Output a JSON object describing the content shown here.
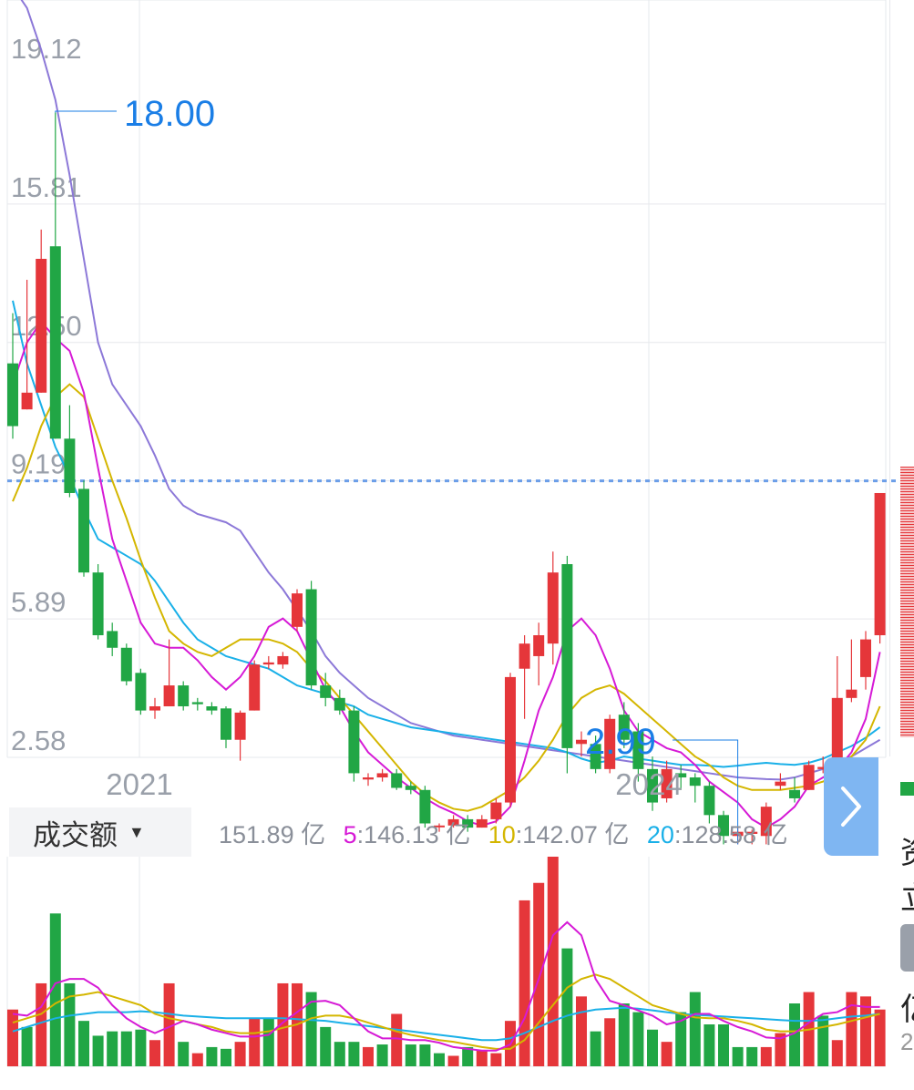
{
  "colors": {
    "up": "#e5363a",
    "down": "#21a645",
    "ma5": "#d61ad6",
    "ma10": "#d4b600",
    "ma20": "#1ab0e8",
    "ma60": "#8c78d8",
    "axis_text": "#9aa0aa",
    "annotation": "#1a7ee6",
    "grid": "#e6e8ec",
    "dashed_line": "#6b9ee8"
  },
  "chart_data": [
    {
      "type": "candlestick",
      "y_ticks": [
        "19.12",
        "15.81",
        "12.50",
        "9.19",
        "5.89",
        "2.58"
      ],
      "x_ticks": [
        "2021",
        "2024"
      ],
      "ylim": [
        2.58,
        19.12
      ],
      "current_price_line": 9.19,
      "annotations": {
        "high_label": "18.00",
        "low_label": "2.99"
      },
      "candles": [
        [
          12.0,
          10.5,
          13.2,
          10.2
        ],
        [
          10.9,
          11.3,
          14.0,
          10.9
        ],
        [
          11.3,
          14.5,
          15.2,
          11.3
        ],
        [
          14.8,
          10.2,
          18.0,
          10.2
        ],
        [
          10.2,
          8.9,
          11.0,
          8.8
        ],
        [
          9.0,
          7.0,
          9.2,
          6.9
        ],
        [
          7.0,
          5.5,
          7.2,
          5.4
        ],
        [
          5.6,
          5.2,
          5.8,
          5.0
        ],
        [
          5.2,
          4.4,
          5.3,
          4.3
        ],
        [
          4.6,
          3.7,
          4.7,
          3.6
        ],
        [
          3.7,
          3.8,
          4.0,
          3.5
        ],
        [
          3.8,
          4.3,
          5.4,
          3.8
        ],
        [
          4.3,
          3.8,
          4.4,
          3.7
        ],
        [
          3.9,
          3.85,
          4.0,
          3.7
        ],
        [
          3.8,
          3.7,
          3.9,
          3.6
        ],
        [
          3.75,
          3.0,
          3.8,
          2.8
        ],
        [
          3.0,
          3.65,
          3.7,
          2.5
        ],
        [
          3.7,
          4.8,
          4.9,
          3.7
        ],
        [
          4.8,
          4.85,
          5.0,
          4.7
        ],
        [
          4.8,
          5.0,
          5.1,
          4.7
        ],
        [
          5.7,
          6.5,
          6.6,
          5.6
        ],
        [
          6.6,
          4.3,
          6.8,
          4.2
        ],
        [
          4.3,
          4.0,
          4.6,
          3.8
        ],
        [
          4.0,
          3.7,
          4.2,
          3.6
        ],
        [
          3.7,
          2.2,
          3.8,
          2.0
        ],
        [
          2.05,
          2.1,
          2.2,
          1.9
        ],
        [
          2.1,
          2.2,
          2.3,
          2.0
        ],
        [
          2.2,
          1.85,
          2.3,
          1.8
        ],
        [
          1.9,
          1.8,
          2.0,
          1.7
        ],
        [
          1.8,
          1.0,
          1.9,
          0.9
        ],
        [
          0.95,
          0.95,
          1.0,
          0.8
        ],
        [
          0.95,
          1.1,
          1.2,
          0.9
        ],
        [
          1.1,
          0.9,
          1.2,
          0.8
        ],
        [
          0.9,
          1.1,
          1.2,
          0.9
        ],
        [
          1.1,
          1.5,
          1.6,
          1.0
        ],
        [
          1.5,
          4.5,
          4.6,
          1.4
        ],
        [
          4.7,
          5.3,
          5.5,
          3.5
        ],
        [
          5.0,
          5.5,
          5.8,
          4.3
        ],
        [
          5.3,
          7.0,
          7.5,
          4.8
        ],
        [
          7.2,
          2.8,
          7.4,
          2.2
        ],
        [
          2.9,
          3.0,
          3.2,
          2.6
        ],
        [
          2.9,
          2.3,
          3.1,
          2.2
        ],
        [
          2.3,
          3.5,
          3.6,
          2.2
        ],
        [
          3.6,
          3.0,
          3.9,
          2.8
        ],
        [
          3.2,
          2.3,
          3.4,
          2.0
        ],
        [
          2.3,
          1.5,
          2.6,
          1.3
        ],
        [
          1.6,
          2.3,
          2.5,
          1.5
        ],
        [
          2.2,
          2.1,
          2.4,
          1.8
        ],
        [
          2.1,
          1.9,
          2.2,
          1.5
        ],
        [
          1.9,
          1.2,
          2.0,
          1.0
        ],
        [
          1.2,
          0.7,
          1.3,
          0.5
        ],
        [
          0.7,
          0.8,
          0.9,
          0.5
        ],
        [
          0.75,
          0.8,
          0.85,
          0.5
        ],
        [
          0.7,
          1.4,
          1.5,
          0.5
        ],
        [
          1.9,
          2.0,
          2.2,
          1.8
        ],
        [
          1.8,
          1.6,
          2.1,
          1.5
        ],
        [
          1.8,
          2.4,
          2.5,
          1.8
        ],
        [
          2.3,
          2.35,
          2.6,
          2.2
        ],
        [
          2.2,
          4.0,
          5.0,
          2.0
        ],
        [
          4.0,
          4.2,
          5.4,
          3.9
        ],
        [
          4.5,
          5.4,
          5.6,
          4.2
        ],
        [
          5.5,
          8.9,
          8.9,
          5.3
        ]
      ],
      "ma_lines": {
        "ma5": [
          11.5,
          12.5,
          13.0,
          12.6,
          12.3,
          11.3,
          9.5,
          7.8,
          6.8,
          5.8,
          5.3,
          5.2,
          5.2,
          4.9,
          4.5,
          4.2,
          4.5,
          5.0,
          5.7,
          5.9,
          5.6,
          4.9,
          4.2,
          3.8,
          3.2,
          2.7,
          2.4,
          2.1,
          1.85,
          1.6,
          1.4,
          1.25,
          1.05,
          0.95,
          1.05,
          1.4,
          2.5,
          3.7,
          4.5,
          5.6,
          5.9,
          5.5,
          4.7,
          3.7,
          3.2,
          3.0,
          2.8,
          2.7,
          2.4,
          2.0,
          1.75,
          1.5,
          1.1,
          0.9,
          1.1,
          1.4,
          1.9,
          2.1,
          2.3,
          2.7,
          3.5,
          5.1
        ],
        "ma10": [
          8.7,
          9.5,
          10.5,
          11.2,
          11.5,
          11.2,
          10.2,
          9.2,
          8.3,
          7.3,
          6.4,
          5.6,
          5.3,
          5.1,
          5.0,
          5.2,
          5.4,
          5.4,
          5.4,
          5.3,
          5.1,
          4.7,
          4.4,
          4.0,
          3.6,
          3.2,
          2.8,
          2.4,
          2.0,
          1.7,
          1.5,
          1.35,
          1.3,
          1.4,
          1.6,
          1.8,
          2.1,
          2.5,
          3.0,
          3.6,
          4.0,
          4.2,
          4.3,
          4.1,
          3.8,
          3.5,
          3.2,
          2.9,
          2.6,
          2.4,
          2.1,
          1.9,
          1.8,
          1.8,
          1.8,
          1.85,
          1.9,
          2.0,
          2.2,
          2.6,
          3.0,
          3.8
        ],
        "ma20": [
          13.5,
          12.0,
          11.0,
          10.0,
          9.3,
          8.5,
          7.8,
          7.6,
          7.4,
          7.2,
          6.8,
          6.3,
          5.8,
          5.4,
          5.2,
          5.0,
          4.9,
          4.8,
          4.7,
          4.5,
          4.3,
          4.2,
          4.1,
          3.9,
          3.8,
          3.6,
          3.5,
          3.4,
          3.3,
          3.25,
          3.2,
          3.15,
          3.1,
          3.05,
          3.0,
          2.95,
          2.9,
          2.85,
          2.8,
          2.7,
          2.55,
          2.45,
          2.5,
          2.6,
          2.55,
          2.5,
          2.45,
          2.4,
          2.4,
          2.38,
          2.35,
          2.38,
          2.42,
          2.45,
          2.42,
          2.4,
          2.45,
          2.55,
          2.7,
          2.85,
          3.05,
          3.3
        ],
        "ma60": [
          21.0,
          20.5,
          19.5,
          18.3,
          16.5,
          14.5,
          12.5,
          11.5,
          11.0,
          10.5,
          9.8,
          9.0,
          8.6,
          8.4,
          8.3,
          8.2,
          8.0,
          7.5,
          7.0,
          6.6,
          6.1,
          5.6,
          5.0,
          4.6,
          4.3,
          4.0,
          3.8,
          3.6,
          3.4,
          3.3,
          3.2,
          3.1,
          3.05,
          3.0,
          2.95,
          2.9,
          2.85,
          2.8,
          2.75,
          2.7,
          2.65,
          2.6,
          2.55,
          2.5,
          2.45,
          2.4,
          2.35,
          2.3,
          2.25,
          2.2,
          2.15,
          2.1,
          2.08,
          2.06,
          2.05,
          2.1,
          2.2,
          2.3,
          2.45,
          2.6,
          2.8,
          3.0
        ]
      }
    },
    {
      "type": "bar",
      "title": "成交额",
      "legend": [
        {
          "label": "151.89 亿",
          "key": "",
          "value": ""
        },
        {
          "label": "5",
          "value": ":146.13 亿"
        },
        {
          "label": "10",
          "value": ":142.07 亿"
        },
        {
          "label": "20",
          "value": ":128.58 亿"
        }
      ],
      "values": [
        65,
        45,
        95,
        175,
        95,
        52,
        35,
        40,
        40,
        42,
        30,
        95,
        28,
        15,
        22,
        20,
        28,
        55,
        55,
        95,
        95,
        85,
        45,
        28,
        28,
        22,
        25,
        60,
        25,
        25,
        15,
        12,
        22,
        18,
        15,
        52,
        190,
        210,
        240,
        135,
        80,
        40,
        55,
        72,
        62,
        42,
        28,
        62,
        85,
        48,
        48,
        22,
        22,
        22,
        38,
        72,
        85,
        58,
        30,
        85,
        80,
        65
      ],
      "up": [
        1,
        0,
        1,
        0,
        0,
        0,
        0,
        0,
        0,
        0,
        1,
        1,
        0,
        1,
        0,
        0,
        1,
        1,
        0,
        1,
        1,
        0,
        0,
        0,
        0,
        1,
        0,
        1,
        0,
        0,
        0,
        1,
        0,
        1,
        1,
        1,
        1,
        1,
        1,
        0,
        1,
        0,
        1,
        0,
        0,
        0,
        1,
        0,
        0,
        0,
        0,
        0,
        0,
        1,
        1,
        0,
        1,
        0,
        1,
        1,
        1,
        1
      ],
      "ma_lines": {
        "ma5": [
          60,
          58,
          68,
          95,
          100,
          100,
          90,
          70,
          55,
          45,
          38,
          45,
          52,
          48,
          42,
          38,
          34,
          34,
          36,
          50,
          62,
          74,
          75,
          70,
          55,
          40,
          32,
          32,
          30,
          30,
          27,
          22,
          20,
          18,
          18,
          25,
          55,
          100,
          150,
          165,
          150,
          100,
          75,
          70,
          64,
          58,
          48,
          52,
          60,
          60,
          52,
          45,
          40,
          33,
          32,
          38,
          50,
          60,
          62,
          70,
          68,
          68
        ],
        "ma10": [
          50,
          55,
          60,
          72,
          80,
          82,
          85,
          80,
          75,
          70,
          60,
          55,
          52,
          48,
          45,
          40,
          38,
          38,
          40,
          44,
          48,
          55,
          58,
          58,
          55,
          50,
          45,
          40,
          36,
          33,
          30,
          28,
          25,
          22,
          20,
          20,
          30,
          50,
          70,
          90,
          100,
          105,
          100,
          90,
          80,
          70,
          65,
          60,
          56,
          55,
          55,
          52,
          48,
          42,
          40,
          40,
          42,
          45,
          48,
          52,
          56,
          60
        ],
        "ma20": [
          40,
          45,
          50,
          55,
          58,
          60,
          62,
          62,
          62,
          63,
          62,
          60,
          58,
          57,
          56,
          55,
          55,
          55,
          55,
          55,
          54,
          53,
          52,
          50,
          48,
          46,
          44,
          42,
          40,
          38,
          36,
          34,
          32,
          30,
          30,
          32,
          38,
          45,
          52,
          58,
          62,
          65,
          66,
          67,
          66,
          64,
          62,
          60,
          59,
          58,
          57,
          56,
          55,
          54,
          53,
          52,
          52,
          53,
          55,
          57,
          58,
          60
        ]
      }
    }
  ],
  "ui": {
    "next_button_icon": "chevron-right-icon",
    "side_fragments": [
      "资",
      "立",
      "亿",
      "2"
    ]
  }
}
